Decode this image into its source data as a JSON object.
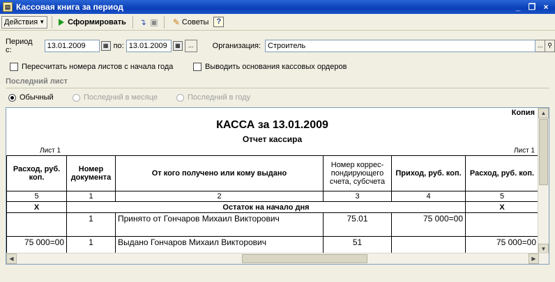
{
  "window": {
    "title": "Кассовая книга за период",
    "app_icon": "book-icon",
    "controls": [
      "_",
      "❐",
      "×"
    ]
  },
  "toolbar": {
    "actions_label": "Действия",
    "generate_label": "Сформировать",
    "tips_label": "Советы",
    "help_label": "?"
  },
  "filters": {
    "period_from_label": "Период с:",
    "period_from_value": "13.01.2009",
    "period_to_label": "по:",
    "period_to_value": "13.01.2009",
    "period_btn": "...",
    "org_label": "Организация:",
    "org_value": "Строитель",
    "org_btn": "...",
    "recalc_label": "Пересчитать номера листов с начала года",
    "recalc_checked": false,
    "basis_label": "Выводить основания кассовых ордеров",
    "basis_checked": false
  },
  "last_sheet": {
    "title": "Последний лист",
    "options": [
      {
        "label": "Обычный",
        "selected": true,
        "enabled": true
      },
      {
        "label": "Последний в месяце",
        "selected": false,
        "enabled": false
      },
      {
        "label": "Последний в году",
        "selected": false,
        "enabled": false
      }
    ]
  },
  "report": {
    "copy_label": "Копия",
    "heading": "КАССА за 13.01.2009",
    "subheading": "Отчет кассира",
    "sheet_left": "Лист 1",
    "sheet_right": "Лист 1",
    "columns": [
      "Расход, руб. коп.",
      "Номер документа",
      "От кого получено или кому выдано",
      "Номер коррес-пондирующего счета, субсчета",
      "Приход, руб. коп.",
      "Расход, руб. коп."
    ],
    "column_numbers": [
      "5",
      "1",
      "2",
      "3",
      "4",
      "5"
    ],
    "balance_row": {
      "left": "X",
      "label": "Остаток на начало дня",
      "right": "X"
    },
    "rows": [
      {
        "left_expense": "",
        "doc": "1",
        "party": "Принято от Гончаров Михаил Викторович",
        "account": "75.01",
        "income": "75 000=00",
        "expense": ""
      },
      {
        "left_expense": "75 000=00",
        "doc": "1",
        "party": "Выдано Гончаров Михаил Викторович",
        "account": "51",
        "income": "",
        "expense": "75 000=00"
      }
    ]
  }
}
